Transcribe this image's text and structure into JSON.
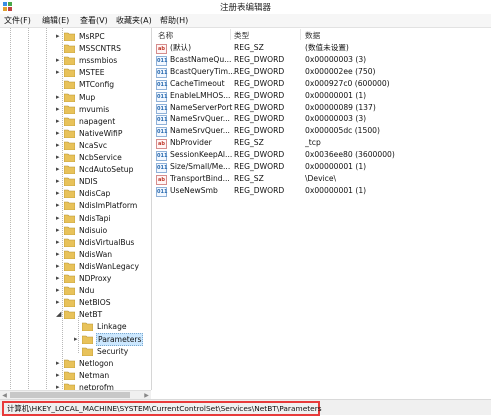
{
  "window": {
    "title": "注册表编辑器"
  },
  "menu": [
    "文件(F)",
    "编辑(E)",
    "查看(V)",
    "收藏夹(A)",
    "帮助(H)"
  ],
  "tree": [
    {
      "label": "MsRPC",
      "expander": "▸"
    },
    {
      "label": "MSSCNTRS",
      "expander": ""
    },
    {
      "label": "mssmbios",
      "expander": "▸"
    },
    {
      "label": "MSTEE",
      "expander": "▸"
    },
    {
      "label": "MTConfig",
      "expander": ""
    },
    {
      "label": "Mup",
      "expander": "▸"
    },
    {
      "label": "mvumis",
      "expander": "▸"
    },
    {
      "label": "napagent",
      "expander": "▸"
    },
    {
      "label": "NativeWifiP",
      "expander": "▸"
    },
    {
      "label": "NcaSvc",
      "expander": "▸"
    },
    {
      "label": "NcbService",
      "expander": "▸"
    },
    {
      "label": "NcdAutoSetup",
      "expander": "▸"
    },
    {
      "label": "NDIS",
      "expander": "▸"
    },
    {
      "label": "NdisCap",
      "expander": "▸"
    },
    {
      "label": "NdisImPlatform",
      "expander": "▸"
    },
    {
      "label": "NdisTapi",
      "expander": "▸"
    },
    {
      "label": "Ndisuio",
      "expander": "▸"
    },
    {
      "label": "NdisVirtualBus",
      "expander": "▸"
    },
    {
      "label": "NdisWan",
      "expander": "▸"
    },
    {
      "label": "NdisWanLegacy",
      "expander": "▸"
    },
    {
      "label": "NDProxy",
      "expander": "▸"
    },
    {
      "label": "Ndu",
      "expander": "▸"
    },
    {
      "label": "NetBIOS",
      "expander": "▸"
    },
    {
      "label": "NetBT",
      "expander": "◢"
    },
    {
      "label": "Linkage",
      "expander": ""
    },
    {
      "label": "Parameters",
      "expander": "▸"
    },
    {
      "label": "Security",
      "expander": ""
    },
    {
      "label": "Netlogon",
      "expander": "▸"
    },
    {
      "label": "Netman",
      "expander": "▸"
    },
    {
      "label": "netprofm",
      "expander": "▸"
    }
  ],
  "columns": {
    "name": "名称",
    "type": "类型",
    "data": "数据"
  },
  "values": [
    {
      "icon": "ab",
      "name": "(默认)",
      "type": "REG_SZ",
      "data": "(数值未设置)"
    },
    {
      "icon": "dw",
      "name": "BcastNameQu...",
      "type": "REG_DWORD",
      "data": "0x00000003 (3)"
    },
    {
      "icon": "dw",
      "name": "BcastQueryTim...",
      "type": "REG_DWORD",
      "data": "0x000002ee (750)"
    },
    {
      "icon": "dw",
      "name": "CacheTimeout",
      "type": "REG_DWORD",
      "data": "0x000927c0 (600000)"
    },
    {
      "icon": "dw",
      "name": "EnableLMHOS...",
      "type": "REG_DWORD",
      "data": "0x00000001 (1)"
    },
    {
      "icon": "dw",
      "name": "NameServerPort",
      "type": "REG_DWORD",
      "data": "0x00000089 (137)"
    },
    {
      "icon": "dw",
      "name": "NameSrvQuer...",
      "type": "REG_DWORD",
      "data": "0x00000003 (3)"
    },
    {
      "icon": "dw",
      "name": "NameSrvQuer...",
      "type": "REG_DWORD",
      "data": "0x000005dc (1500)"
    },
    {
      "icon": "ab",
      "name": "NbProvider",
      "type": "REG_SZ",
      "data": "_tcp"
    },
    {
      "icon": "dw",
      "name": "SessionKeepAl...",
      "type": "REG_DWORD",
      "data": "0x0036ee80 (3600000)"
    },
    {
      "icon": "dw",
      "name": "Size/Small/Me...",
      "type": "REG_DWORD",
      "data": "0x00000001 (1)"
    },
    {
      "icon": "ab",
      "name": "TransportBind...",
      "type": "REG_SZ",
      "data": "\\Device\\"
    },
    {
      "icon": "dw",
      "name": "UseNewSmb",
      "type": "REG_DWORD",
      "data": "0x00000001 (1)"
    }
  ],
  "status": {
    "path": "计算机\\HKEY_LOCAL_MACHINE\\SYSTEM\\CurrentControlSet\\Services\\NetBT\\Parameters"
  },
  "colors": {
    "highlight": "#e83a3a",
    "folder": "#e8c25a",
    "selection": "#cce8ff"
  }
}
